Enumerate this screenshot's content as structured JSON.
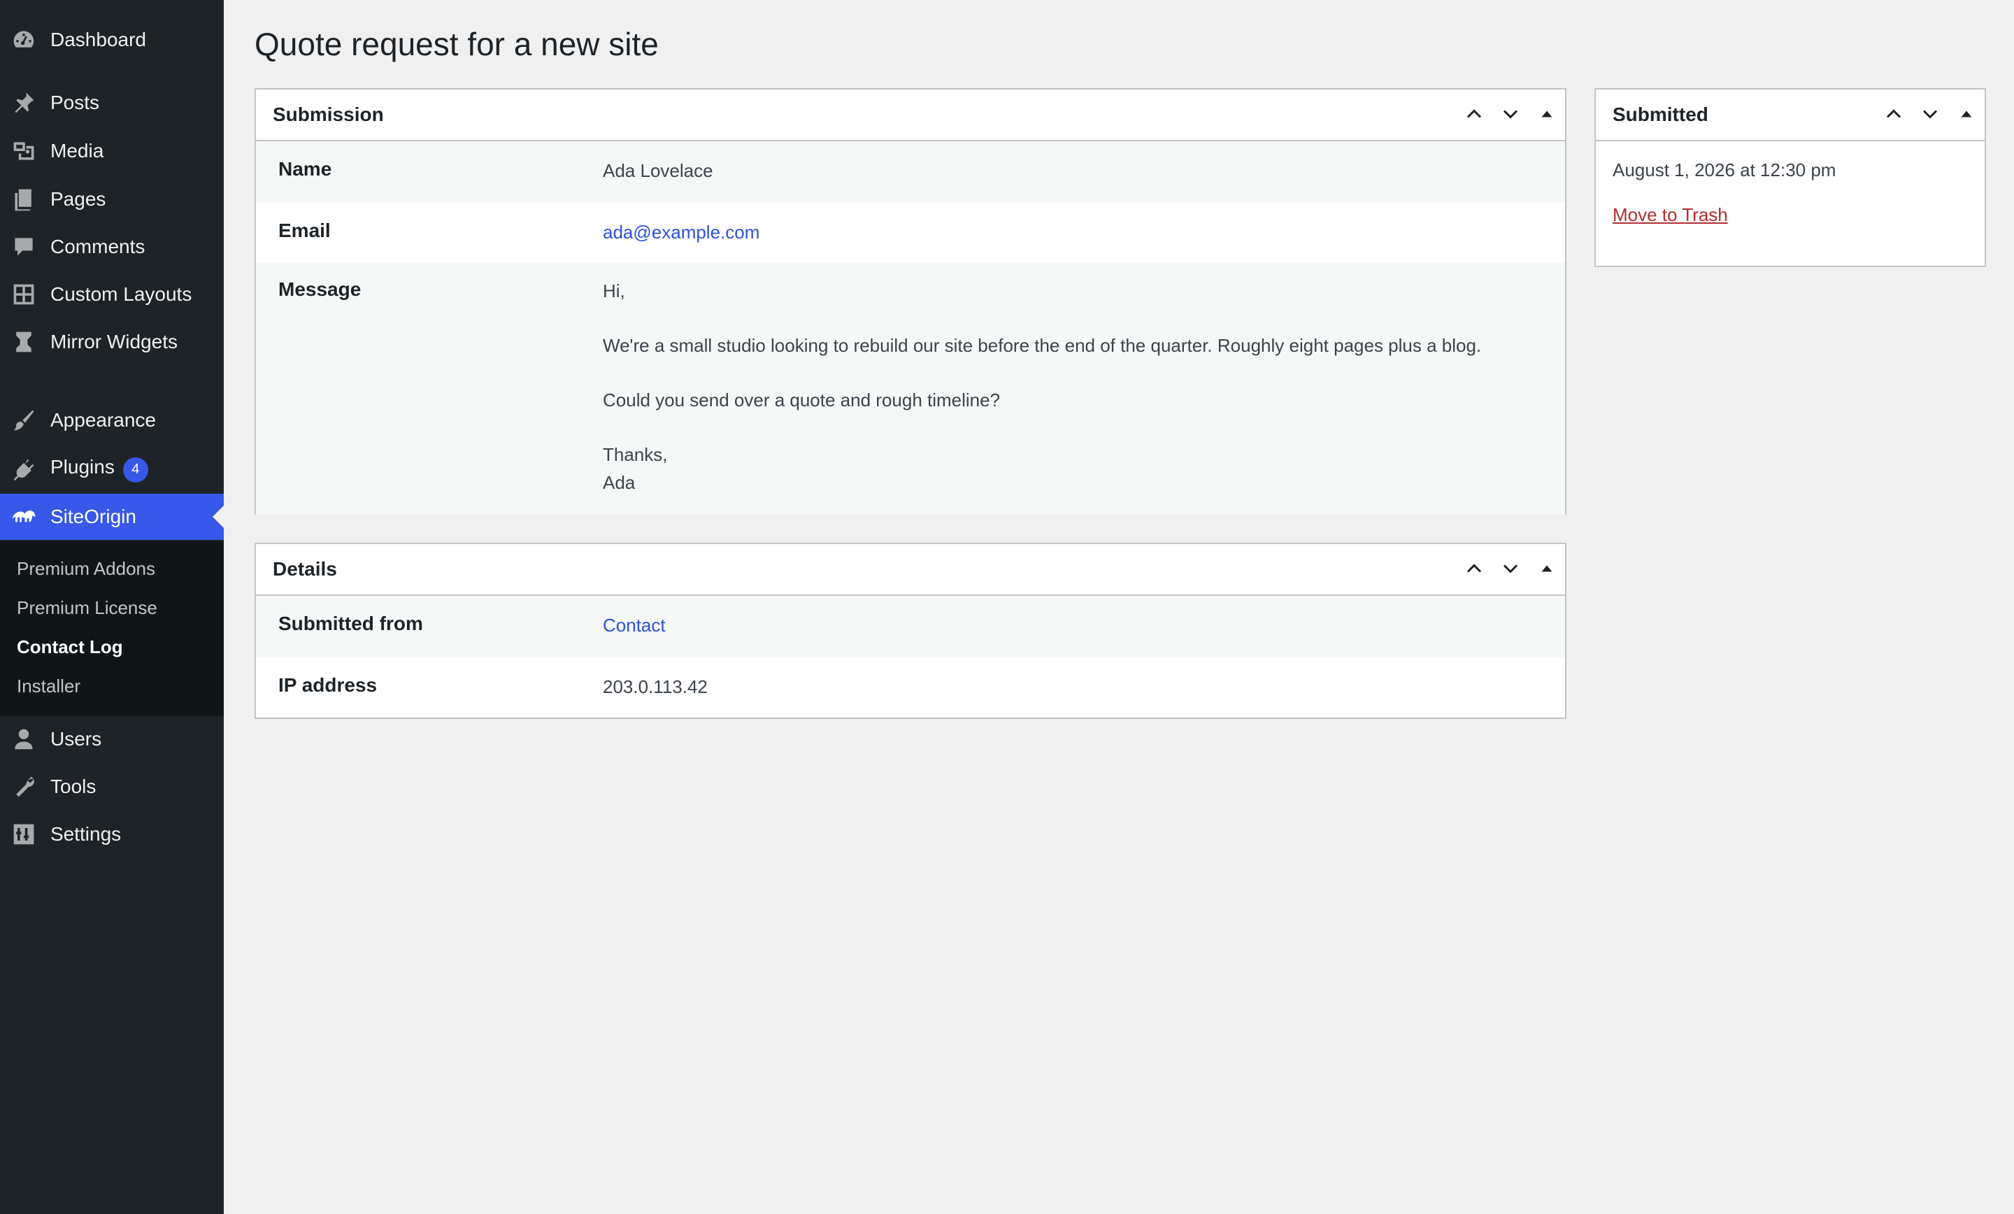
{
  "sidebar": {
    "items": [
      {
        "label": "Dashboard",
        "icon": "dashboard-icon"
      },
      {
        "label": "Posts",
        "icon": "pin-icon"
      },
      {
        "label": "Media",
        "icon": "media-icon"
      },
      {
        "label": "Pages",
        "icon": "pages-icon"
      },
      {
        "label": "Comments",
        "icon": "comment-icon"
      },
      {
        "label": "Custom Layouts",
        "icon": "layout-icon"
      },
      {
        "label": "Mirror Widgets",
        "icon": "mirror-icon"
      },
      {
        "label": "Appearance",
        "icon": "brush-icon"
      },
      {
        "label": "Plugins",
        "icon": "plugin-icon",
        "badge": "4"
      },
      {
        "label": "SiteOrigin",
        "icon": "siteorigin-icon"
      },
      {
        "label": "Users",
        "icon": "user-icon"
      },
      {
        "label": "Tools",
        "icon": "wrench-icon"
      },
      {
        "label": "Settings",
        "icon": "settings-icon"
      }
    ],
    "submenu": [
      {
        "label": "Premium Addons"
      },
      {
        "label": "Premium License"
      },
      {
        "label": "Contact Log"
      },
      {
        "label": "Installer"
      }
    ],
    "active_color": "#3858e9"
  },
  "page": {
    "title": "Quote request for a new site"
  },
  "submission": {
    "title": "Submission",
    "name_label": "Name",
    "name_value": "Ada Lovelace",
    "email_label": "Email",
    "email_value": "ada@example.com",
    "message_label": "Message",
    "message_lines": {
      "l1": "Hi,",
      "l2": "We're a small studio looking to rebuild our site before the end of the quarter. Roughly eight pages plus a blog.",
      "l3": "Could you send over a quote and rough timeline?",
      "l4": "Thanks,",
      "l5": "Ada"
    }
  },
  "details": {
    "title": "Details",
    "from_label": "Submitted from",
    "from_value": "Contact",
    "ip_label": "IP address",
    "ip_value": "203.0.113.42"
  },
  "submitted": {
    "title": "Submitted",
    "date": "August 1, 2026 at 12:30 pm",
    "trash_label": "Move to Trash"
  }
}
